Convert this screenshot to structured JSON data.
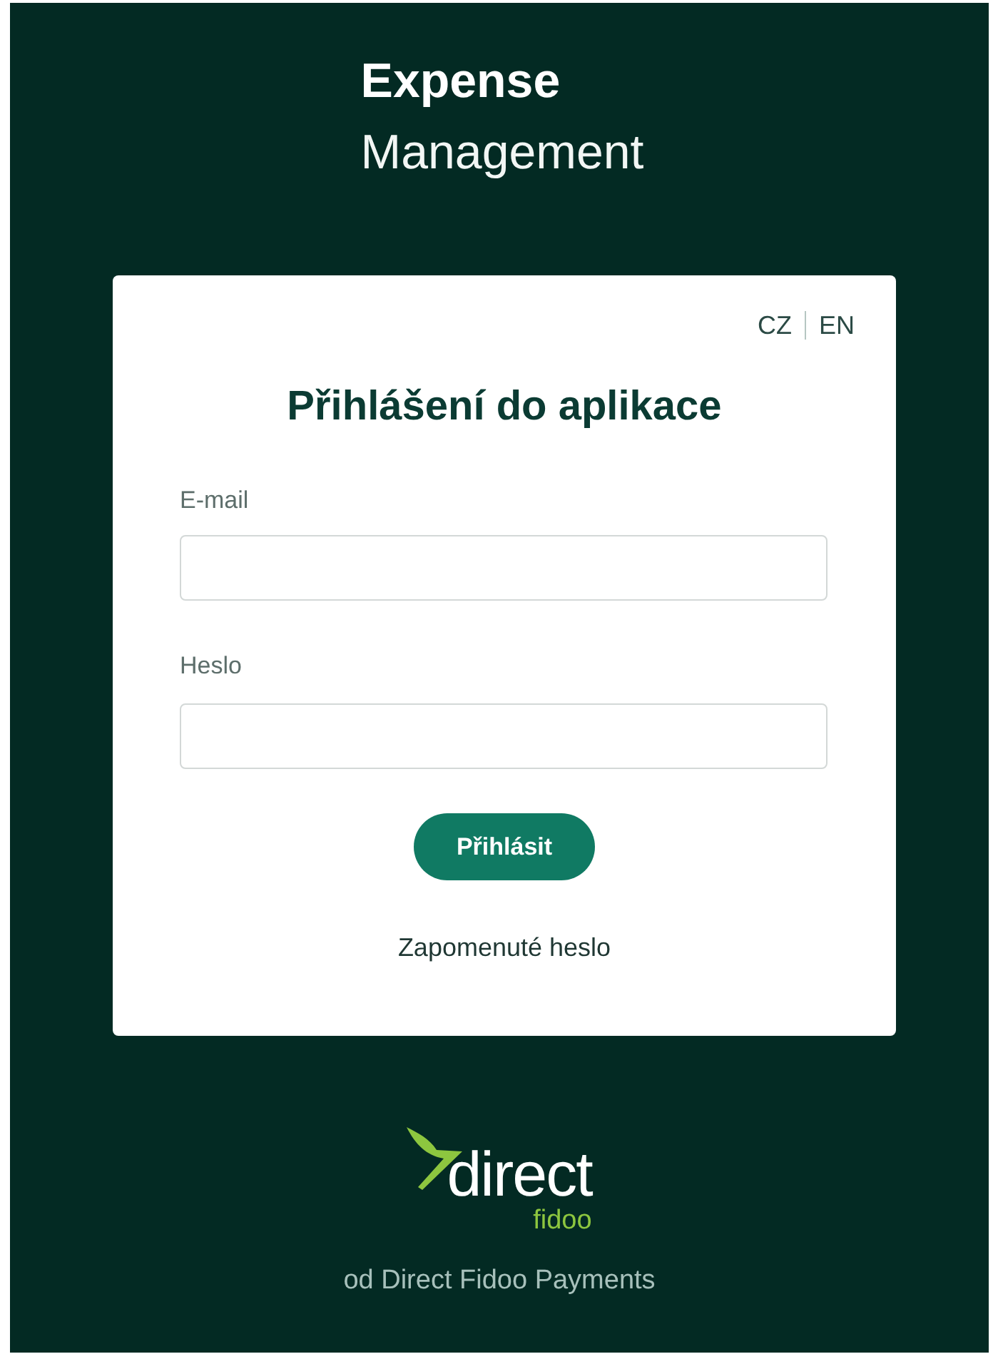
{
  "app_title": {
    "line_1": "Expense",
    "line_2": "Management"
  },
  "login_card": {
    "languages": [
      {
        "label": "CZ"
      },
      {
        "label": "EN"
      }
    ],
    "heading": "Přihlášení do aplikace",
    "fields": [
      {
        "label": "E-mail"
      },
      {
        "label": "Heslo"
      }
    ],
    "submit_button": "Přihlásit",
    "forgot_password_link": "Zapomenuté heslo"
  },
  "footer": {
    "logo": {
      "wordmark": "direct",
      "sub_wordmark": "fidoo"
    },
    "tagline": "od Direct Fidoo Payments"
  }
}
